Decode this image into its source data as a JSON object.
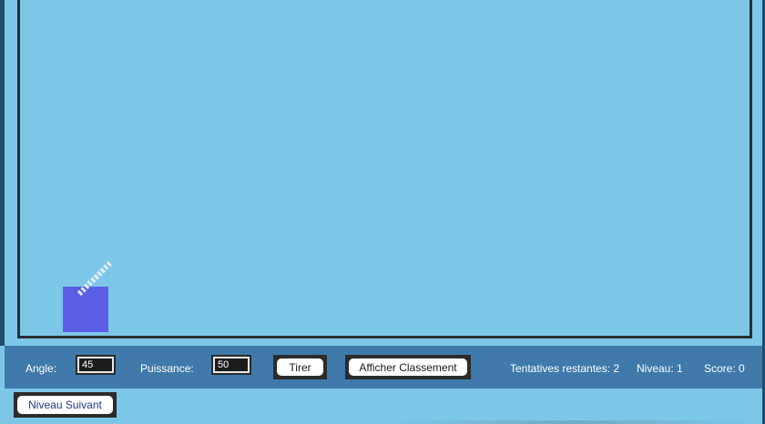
{
  "controls": {
    "angle_label": "Angle:",
    "angle_value": "45",
    "power_label": "Puissance:",
    "power_value": "50",
    "fire_label": "Tirer",
    "leaderboard_label": "Afficher Classement",
    "next_level_label": "Niveau Suivant"
  },
  "status": {
    "attempts": "Tentatives restantes: 2",
    "level": "Niveau: 1",
    "score": "Score: 0"
  },
  "game": {
    "cannon_angle_deg": 45,
    "cannon_color": "#5a5fe6",
    "sky_color": "#7cc7e8",
    "panel_color": "#3f7aaa"
  }
}
